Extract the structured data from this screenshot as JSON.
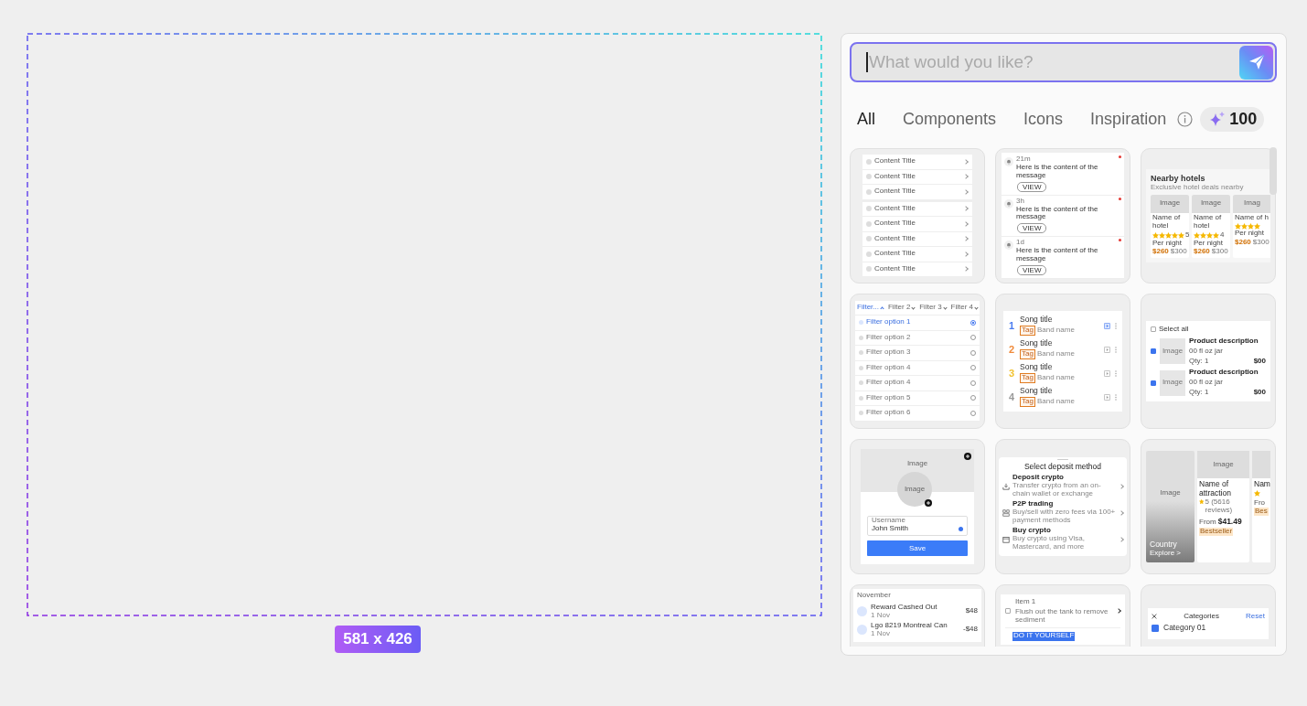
{
  "canvas": {
    "size_label": "581 x 426"
  },
  "prompt": {
    "placeholder": "What would you like?"
  },
  "tabs": [
    {
      "label": "All",
      "selected": true
    },
    {
      "label": "Components",
      "selected": false
    },
    {
      "label": "Icons",
      "selected": false
    },
    {
      "label": "Inspiration",
      "selected": false
    }
  ],
  "credits": "100",
  "templates": [
    {
      "kind": "list",
      "groups": [
        [
          "Content Title",
          "Content Title",
          "Content Title"
        ],
        [
          "Content Title",
          "Content Title",
          "Content Title",
          "Content Title",
          "Content Title"
        ]
      ]
    },
    {
      "kind": "notifications",
      "items": [
        {
          "time": "21m",
          "message": "Here is the content of the message",
          "action": "VIEW"
        },
        {
          "time": "3h",
          "message": "Here is the content of the message",
          "action": "VIEW"
        },
        {
          "time": "1d",
          "message": "Here is the content of the message",
          "action": "VIEW"
        }
      ]
    },
    {
      "kind": "hotels",
      "title": "Nearby hotels",
      "subtitle": "Exclusive hotel deals nearby",
      "hotels": [
        {
          "image": "Image",
          "name": "Name of hotel",
          "stars": 5,
          "rating": "5",
          "per": "Per night",
          "price": "$260",
          "old_price": "$300"
        },
        {
          "image": "Image",
          "name": "Name of hotel",
          "stars": 4,
          "rating": "4",
          "per": "Per night",
          "price": "$260",
          "old_price": "$300"
        },
        {
          "image": "Imag",
          "name": "Name of h",
          "stars": 4,
          "per": "Per night",
          "price": "$260",
          "old_price": "$300"
        }
      ]
    },
    {
      "kind": "filters",
      "filters": [
        {
          "label": "Filter...",
          "selected": true
        },
        {
          "label": "Filter 2",
          "selected": false
        },
        {
          "label": "Filter 3",
          "selected": false
        },
        {
          "label": "Filter 4",
          "selected": false
        }
      ],
      "options": [
        {
          "label": "Filter option 1",
          "selected": true
        },
        {
          "label": "Filter option 2",
          "selected": false
        },
        {
          "label": "Filter option 3",
          "selected": false
        },
        {
          "label": "Filter option 4",
          "selected": false
        },
        {
          "label": "Filter option 4",
          "selected": false
        },
        {
          "label": "Filter option 5",
          "selected": false
        },
        {
          "label": "Filter option 6",
          "selected": false
        }
      ]
    },
    {
      "kind": "songs",
      "songs": [
        {
          "number": "1",
          "color": "#4a7cf0",
          "title": "Song title",
          "tag": "Tag",
          "band": "Band name",
          "selected": true
        },
        {
          "number": "2",
          "color": "#f08a3a",
          "title": "Song title",
          "tag": "Tag",
          "band": "Band name",
          "selected": false
        },
        {
          "number": "3",
          "color": "#f2c230",
          "title": "Song title",
          "tag": "Tag",
          "band": "Band name",
          "selected": false
        },
        {
          "number": "4",
          "color": "#9a9a9a",
          "title": "Song title",
          "tag": "Tag",
          "band": "Band name",
          "selected": false
        }
      ]
    },
    {
      "kind": "cart",
      "select_all": {
        "label": "Select all",
        "checked": false
      },
      "items": [
        {
          "image": "Image",
          "title": "Product description",
          "size": "00 fl oz jar",
          "qty": "Qty: 1",
          "price": "$00",
          "checked": true
        },
        {
          "image": "Image",
          "title": "Product description",
          "size": "00 fl oz jar",
          "qty": "Qty: 1",
          "price": "$00",
          "checked": true
        }
      ]
    },
    {
      "kind": "profile",
      "cover": "Image",
      "avatar": "Image",
      "field_label": "Username",
      "field_value": "John Smith",
      "button": "Save"
    },
    {
      "kind": "deposit",
      "title": "Select deposit method",
      "options": [
        {
          "title": "Deposit crypto",
          "desc": "Transfer crypto from an on-chain wallet or exchange"
        },
        {
          "title": "P2P trading",
          "desc": "Buy/sell with zero fees via 100+ payment methods"
        },
        {
          "title": "Buy crypto",
          "desc": "Buy crypto using Visa, Mastercard, and more"
        }
      ]
    },
    {
      "kind": "attractions",
      "country": {
        "image": "Image",
        "title": "Country",
        "link": "Explore >"
      },
      "items": [
        {
          "image": "Image",
          "name": "Name of attraction",
          "rating": "5 (5616 reviews)",
          "from": "From",
          "price": "$41.49",
          "tag": "Bestseller"
        },
        {
          "name": "Nam",
          "from": "Fro",
          "tag": "Bes"
        }
      ]
    },
    {
      "kind": "transactions",
      "month": "November",
      "items": [
        {
          "title": "Reward Cashed Out",
          "date": "1 Nov",
          "amount": "$48"
        },
        {
          "title": "Lgo 8219 Montreal Can",
          "date": "1 Nov",
          "amount": "-$48"
        }
      ]
    },
    {
      "kind": "tasks",
      "items": [
        {
          "title": "Item 1",
          "desc": "Flush out the tank to remove sediment",
          "checked": false
        }
      ],
      "badge": "DO IT YOURSELF"
    },
    {
      "kind": "categories",
      "title": "Categories",
      "reset": "Reset",
      "items": [
        {
          "label": "Category 01",
          "checked": true
        }
      ]
    }
  ]
}
